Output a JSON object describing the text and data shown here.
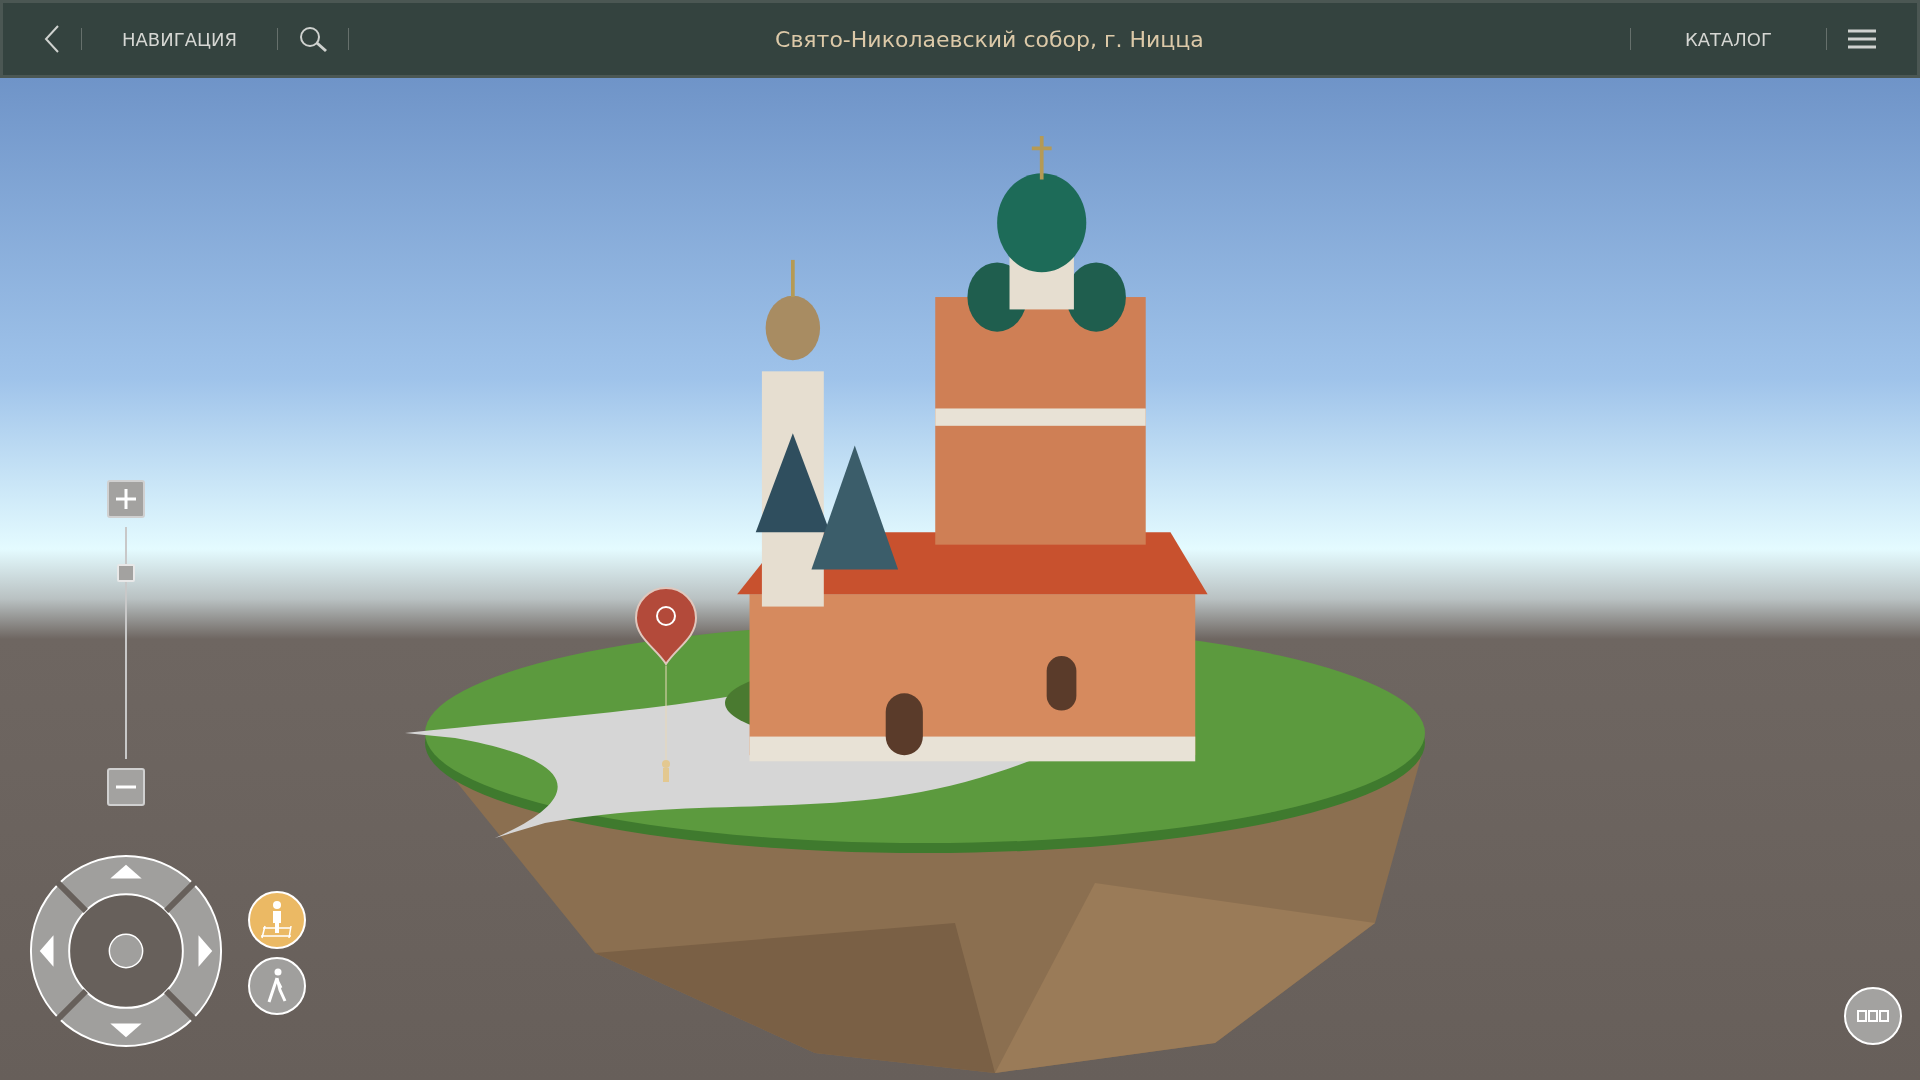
{
  "top_bar": {
    "navigation_label": "НАВИГАЦИЯ",
    "title": "Свято-Николаевский собор, г. Ницца",
    "catalog_label": "КАТАЛОГ"
  },
  "zoom": {
    "level": 0.8
  },
  "view_modes": [
    {
      "kind": "overview",
      "selected": true
    },
    {
      "kind": "walk",
      "selected": false
    }
  ]
}
